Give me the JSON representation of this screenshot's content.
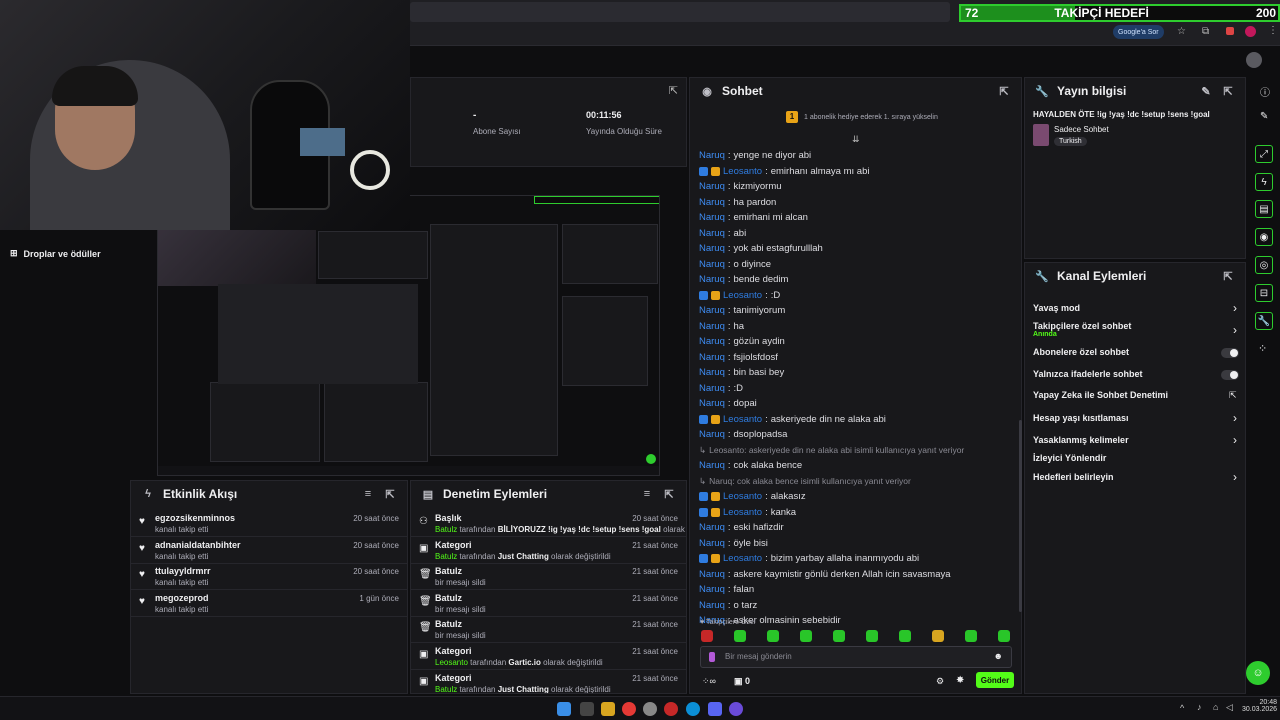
{
  "goal": {
    "current": "72",
    "label": "TAKİPÇİ HEDEFİ",
    "target": "200",
    "progress": 0.36
  },
  "browser": {
    "google_btn": "Google'a Sor"
  },
  "stats": {
    "value1": "-",
    "label1": "Abone Sayısı",
    "value2": "00:11:56",
    "label2": "Yayında Olduğu Süre"
  },
  "left_nav": {
    "item1": "Droplar ve ödüller"
  },
  "chat": {
    "title": "Sohbet",
    "gift_banner": "1 abonelik hediye ederek 1. sıraya yükselin",
    "messages": [
      {
        "nick": "Naruq",
        "text": "yenge ne diyor abi",
        "badges": false
      },
      {
        "nick": "Leosanto",
        "text": "emirhanı almaya mı abi",
        "badges": true
      },
      {
        "nick": "Naruq",
        "text": "kizmiyormu",
        "badges": false
      },
      {
        "nick": "Naruq",
        "text": "ha pardon",
        "badges": false
      },
      {
        "nick": "Naruq",
        "text": "emirhani mi alcan",
        "badges": false
      },
      {
        "nick": "Naruq",
        "text": "abi",
        "badges": false
      },
      {
        "nick": "Naruq",
        "text": "yok abi estagfurulllah",
        "badges": false
      },
      {
        "nick": "Naruq",
        "text": "o diyince",
        "badges": false
      },
      {
        "nick": "Naruq",
        "text": "bende dedim",
        "badges": false
      },
      {
        "nick": "Leosanto",
        "text": ":D",
        "badges": true
      },
      {
        "nick": "Naruq",
        "text": "tanimiyorum",
        "badges": false
      },
      {
        "nick": "Naruq",
        "text": "ha",
        "badges": false
      },
      {
        "nick": "Naruq",
        "text": "gözün aydin",
        "badges": false
      },
      {
        "nick": "Naruq",
        "text": "fsjiolsfdosf",
        "badges": false
      },
      {
        "nick": "Naruq",
        "text": "bin basi bey",
        "badges": false
      },
      {
        "nick": "Naruq",
        "text": ":D",
        "badges": false
      },
      {
        "nick": "Naruq",
        "text": "dopai",
        "badges": false
      },
      {
        "nick": "Leosanto",
        "text": "askeriyede din ne alaka abi",
        "badges": true
      },
      {
        "nick": "Naruq",
        "text": "dsoplopadsa",
        "badges": false
      }
    ],
    "reply1": "Leosanto: askeriyede din ne alaka abi isimli kullanıcıya yanıt veriyor",
    "reply1_msg": {
      "nick": "Naruq",
      "text": "cok alaka bence"
    },
    "reply2": "Naruq: cok alaka bence isimli kullanıcıya yanıt veriyor",
    "messages2": [
      {
        "nick": "Leosanto",
        "text": "alakasız",
        "badges": true
      },
      {
        "nick": "Leosanto",
        "text": "kanka",
        "badges": true
      },
      {
        "nick": "Naruq",
        "text": "eski hafizdir",
        "badges": false
      },
      {
        "nick": "Naruq",
        "text": "öyle bisi",
        "badges": false
      },
      {
        "nick": "Leosanto",
        "text": "bizim yarbay allaha inanmıyodu abi",
        "badges": true
      },
      {
        "nick": "Naruq",
        "text": "askere kaymistir gönlü derken Allah icin savasmaya",
        "badges": false
      },
      {
        "nick": "Naruq",
        "text": "falan",
        "badges": false
      },
      {
        "nick": "Naruq",
        "text": "o tarz",
        "badges": false
      },
      {
        "nick": "Naruq",
        "text": "asker olmasinin sebebidir",
        "badges": false
      }
    ],
    "followers_only": "Takipçilere Özel",
    "input_placeholder": "Bir mesaj gönderin",
    "points": "0",
    "send": "Gönder"
  },
  "stream_info": {
    "title": "Yayın bilgisi",
    "stream_title": "HAYALDEN ÖTE !ig !yaş !dc !setup !sens !goal",
    "category": "Sadece Sohbet",
    "tag": "Turkish"
  },
  "channel_actions": {
    "title": "Kanal Eylemleri",
    "slow_mode": "Yavaş mod",
    "followers_chat": "Takipçilere özel sohbet",
    "followers_chat_sub": "Anında",
    "subs_chat": "Abonelere özel sohbet",
    "emote_only": "Yalnızca ifadelerle sohbet",
    "ai_mod": "Yapay Zeka ile Sohbet Denetimi",
    "account_age": "Hesap yaşı kısıtlaması",
    "banned_words": "Yasaklanmış kelimeler",
    "viewer_redirect": "İzleyici Yönlendir",
    "set_goals": "Hedefleri belirleyin"
  },
  "activity": {
    "title": "Etkinlik Akışı",
    "items": [
      {
        "name": "egzozsikenminnos",
        "sub": "kanalı takip etti",
        "time": "20 saat önce"
      },
      {
        "name": "adnanialdatanbihter",
        "sub": "kanalı takip etti",
        "time": "20 saat önce"
      },
      {
        "name": "ttulayyldrmrr",
        "sub": "kanalı takip etti",
        "time": "20 saat önce"
      },
      {
        "name": "megozeprod",
        "sub": "kanalı takip etti",
        "time": "1 gün önce"
      }
    ]
  },
  "moderation": {
    "title": "Denetim Eylemleri",
    "items": [
      {
        "name": "Başlık",
        "actor": "Batulz",
        "mid": " tarafından ",
        "obj": "BİLİYORUZZ !ig !yaş !dc !setup !sens !goal",
        "end": " olarak değiştirildi",
        "time": "20 saat önce"
      },
      {
        "name": "Kategori",
        "actor": "Batulz",
        "mid": " tarafından ",
        "obj": "Just Chatting",
        "end": " olarak değiştirildi",
        "time": "21 saat önce"
      },
      {
        "name": "Batulz",
        "sub": "bir mesajı sildi",
        "time": "21 saat önce"
      },
      {
        "name": "Batulz",
        "sub": "bir mesajı sildi",
        "time": "21 saat önce"
      },
      {
        "name": "Batulz",
        "sub": "bir mesajı sildi",
        "time": "21 saat önce"
      },
      {
        "name": "Kategori",
        "actor": "Leosanto",
        "mid": " tarafından ",
        "obj": "Gartic.io",
        "end": " olarak değiştirildi",
        "time": "21 saat önce"
      },
      {
        "name": "Kategori",
        "actor": "Batulz",
        "mid": " tarafından ",
        "obj": "Just Chatting",
        "end": " olarak değiştirildi",
        "time": "21 saat önce"
      }
    ]
  },
  "clock": {
    "time": "20:48",
    "date": "30.03.2026"
  },
  "colors": {
    "accent": "#53fc18",
    "chat_nick": "#3e8df4",
    "bg": "#0e0e10",
    "panel": "#18181b"
  }
}
